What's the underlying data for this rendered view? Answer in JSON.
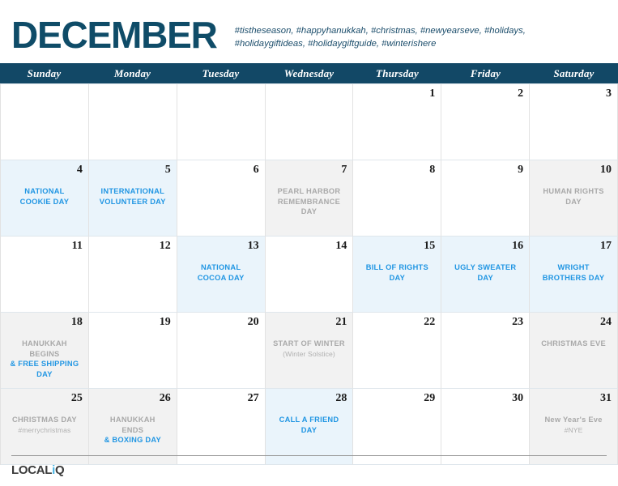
{
  "header": {
    "month_title": "DECEMBER",
    "hashtags": "#tistheseason, #happyhanukkah, #christmas, #newyearseve, #holidays, #holidaygiftideas, #holidaygiftguide, #winterishere"
  },
  "weekdays": [
    {
      "label": "Sunday"
    },
    {
      "label": "Monday"
    },
    {
      "label": "Tuesday"
    },
    {
      "label": "Wednesday"
    },
    {
      "label": "Thursday"
    },
    {
      "label": "Friday"
    },
    {
      "label": "Saturday"
    }
  ],
  "colors": {
    "header_bar": "#124866",
    "title": "#0f4c68",
    "blue_tint": "#eaf4fb",
    "gray_tint": "#f2f2f2",
    "blue_text": "#2196e3",
    "gray_text": "#a9a9a9",
    "logo_accent": "#49b6e6"
  },
  "days": [
    {
      "number": "",
      "tint": "none",
      "events": []
    },
    {
      "number": "",
      "tint": "none",
      "events": []
    },
    {
      "number": "",
      "tint": "none",
      "events": []
    },
    {
      "number": "",
      "tint": "none",
      "events": []
    },
    {
      "number": "1",
      "tint": "none",
      "events": []
    },
    {
      "number": "2",
      "tint": "none",
      "events": []
    },
    {
      "number": "3",
      "tint": "none",
      "events": []
    },
    {
      "number": "4",
      "tint": "blue",
      "events": [
        {
          "text": "NATIONAL",
          "color": "blue",
          "style": "bold"
        },
        {
          "text": "COOKIE DAY",
          "color": "blue",
          "style": "bold"
        }
      ]
    },
    {
      "number": "5",
      "tint": "blue",
      "events": [
        {
          "text": "INTERNATIONAL",
          "color": "blue",
          "style": "bold"
        },
        {
          "text": "VOLUNTEER DAY",
          "color": "blue",
          "style": "bold"
        }
      ]
    },
    {
      "number": "6",
      "tint": "none",
      "events": []
    },
    {
      "number": "7",
      "tint": "gray",
      "events": [
        {
          "text": "PEARL HARBOR",
          "color": "gray",
          "style": "bold"
        },
        {
          "text": "REMEMBRANCE",
          "color": "gray",
          "style": "bold"
        },
        {
          "text": "DAY",
          "color": "gray",
          "style": "bold"
        }
      ]
    },
    {
      "number": "8",
      "tint": "none",
      "events": []
    },
    {
      "number": "9",
      "tint": "none",
      "events": []
    },
    {
      "number": "10",
      "tint": "gray",
      "events": [
        {
          "text": "HUMAN RIGHTS",
          "color": "gray",
          "style": "bold"
        },
        {
          "text": "DAY",
          "color": "gray",
          "style": "bold"
        }
      ]
    },
    {
      "number": "11",
      "tint": "none",
      "events": []
    },
    {
      "number": "12",
      "tint": "none",
      "events": []
    },
    {
      "number": "13",
      "tint": "blue",
      "events": [
        {
          "text": "NATIONAL",
          "color": "blue",
          "style": "bold"
        },
        {
          "text": "COCOA DAY",
          "color": "blue",
          "style": "bold"
        }
      ]
    },
    {
      "number": "14",
      "tint": "none",
      "events": []
    },
    {
      "number": "15",
      "tint": "blue",
      "events": [
        {
          "text": "BILL OF RIGHTS DAY",
          "color": "blue",
          "style": "bold"
        }
      ]
    },
    {
      "number": "16",
      "tint": "blue",
      "events": [
        {
          "text": "UGLY SWEATER",
          "color": "blue",
          "style": "bold"
        },
        {
          "text": "DAY",
          "color": "blue",
          "style": "bold"
        }
      ]
    },
    {
      "number": "17",
      "tint": "blue",
      "events": [
        {
          "text": "WRIGHT",
          "color": "blue",
          "style": "bold"
        },
        {
          "text": "BROTHERS DAY",
          "color": "blue",
          "style": "bold"
        }
      ]
    },
    {
      "number": "18",
      "tint": "gray",
      "events": [
        {
          "text": "HANUKKAH",
          "color": "gray",
          "style": "bold"
        },
        {
          "text": "BEGINS",
          "color": "gray",
          "style": "bold"
        },
        {
          "text": "& FREE SHIPPING",
          "color": "blue",
          "style": "bold"
        },
        {
          "text": "DAY",
          "color": "blue",
          "style": "bold"
        }
      ]
    },
    {
      "number": "19",
      "tint": "none",
      "events": []
    },
    {
      "number": "20",
      "tint": "none",
      "events": []
    },
    {
      "number": "21",
      "tint": "gray",
      "events": [
        {
          "text": "START OF WINTER",
          "color": "gray",
          "style": "bold"
        },
        {
          "text": "(Winter Solstice)",
          "color": "gray",
          "style": "sub"
        }
      ]
    },
    {
      "number": "22",
      "tint": "none",
      "events": []
    },
    {
      "number": "23",
      "tint": "none",
      "events": []
    },
    {
      "number": "24",
      "tint": "gray",
      "events": [
        {
          "text": "CHRISTMAS EVE",
          "color": "gray",
          "style": "bold"
        }
      ]
    },
    {
      "number": "25",
      "tint": "gray",
      "events": [
        {
          "text": "CHRISTMAS DAY",
          "color": "gray",
          "style": "bold"
        },
        {
          "text": "#merrychristmas",
          "color": "gray",
          "style": "sub"
        }
      ]
    },
    {
      "number": "26",
      "tint": "gray",
      "events": [
        {
          "text": "HANUKKAH",
          "color": "gray",
          "style": "bold"
        },
        {
          "text": "ENDS",
          "color": "gray",
          "style": "bold"
        },
        {
          "text": "& BOXING DAY",
          "color": "blue",
          "style": "bold"
        }
      ]
    },
    {
      "number": "27",
      "tint": "none",
      "events": []
    },
    {
      "number": "28",
      "tint": "blue",
      "events": [
        {
          "text": "CALL A FRIEND DAY",
          "color": "blue",
          "style": "bold"
        }
      ]
    },
    {
      "number": "29",
      "tint": "none",
      "events": []
    },
    {
      "number": "30",
      "tint": "none",
      "events": []
    },
    {
      "number": "31",
      "tint": "gray",
      "events": [
        {
          "text": "New Year's Eve",
          "color": "gray",
          "style": "bold"
        },
        {
          "text": "#NYE",
          "color": "gray",
          "style": "sub"
        }
      ]
    }
  ],
  "footer": {
    "logo_prefix": "LOCAL",
    "logo_accent_letter": "i",
    "logo_suffix": "Q"
  }
}
